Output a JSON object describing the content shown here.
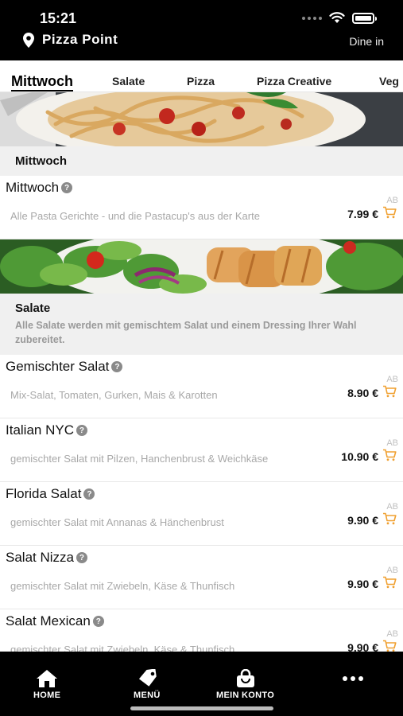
{
  "status_bar": {
    "time": "15:21"
  },
  "header": {
    "store_name": "Pizza Point",
    "mode": "Dine in"
  },
  "tabs": [
    {
      "label": "Mittwoch",
      "active": true
    },
    {
      "label": "Salate",
      "active": false
    },
    {
      "label": "Pizza",
      "active": false
    },
    {
      "label": "Pizza Creative",
      "active": false
    },
    {
      "label": "Veg",
      "active": false
    }
  ],
  "sections": [
    {
      "title": "Mittwoch",
      "description": "",
      "items": [
        {
          "name": "Mittwoch",
          "description": "Alle Pasta Gerichte - und die Pastacup's aus der Karte",
          "price": "7.99 €",
          "badge": "AB"
        }
      ]
    },
    {
      "title": "Salate",
      "description": "Alle Salate werden mit gemischtem Salat und einem Dressing Ihrer Wahl zubereitet.",
      "items": [
        {
          "name": "Gemischter Salat",
          "description": "Mix-Salat, Tomaten, Gurken, Mais & Karotten",
          "price": "8.90 €",
          "badge": "AB"
        },
        {
          "name": "Italian NYC",
          "description": "gemischter Salat mit Pilzen, Hanchenbrust & Weichkäse",
          "price": "10.90 €",
          "badge": "AB"
        },
        {
          "name": "Florida Salat",
          "description": "gemischter Salat mit Annanas & Hänchenbrust",
          "price": "9.90 €",
          "badge": "AB"
        },
        {
          "name": "Salat Nizza",
          "description": "gemischter Salat mit Zwiebeln, Käse & Thunfisch",
          "price": "9.90 €",
          "badge": "AB"
        },
        {
          "name": "Salat Mexican",
          "description": "gemischter Salat mit Zwiebeln, Käse & Thunfisch",
          "price": "9.90 €",
          "badge": "AB"
        }
      ]
    }
  ],
  "bottom_nav": [
    {
      "label": "HOME",
      "icon": "home-icon"
    },
    {
      "label": "MENÜ",
      "icon": "tag-icon"
    },
    {
      "label": "MEIN KONTO",
      "icon": "bag-icon"
    },
    {
      "label": "",
      "icon": "more-icon"
    }
  ],
  "colors": {
    "accent": "#f0a030",
    "bar": "#000000"
  }
}
